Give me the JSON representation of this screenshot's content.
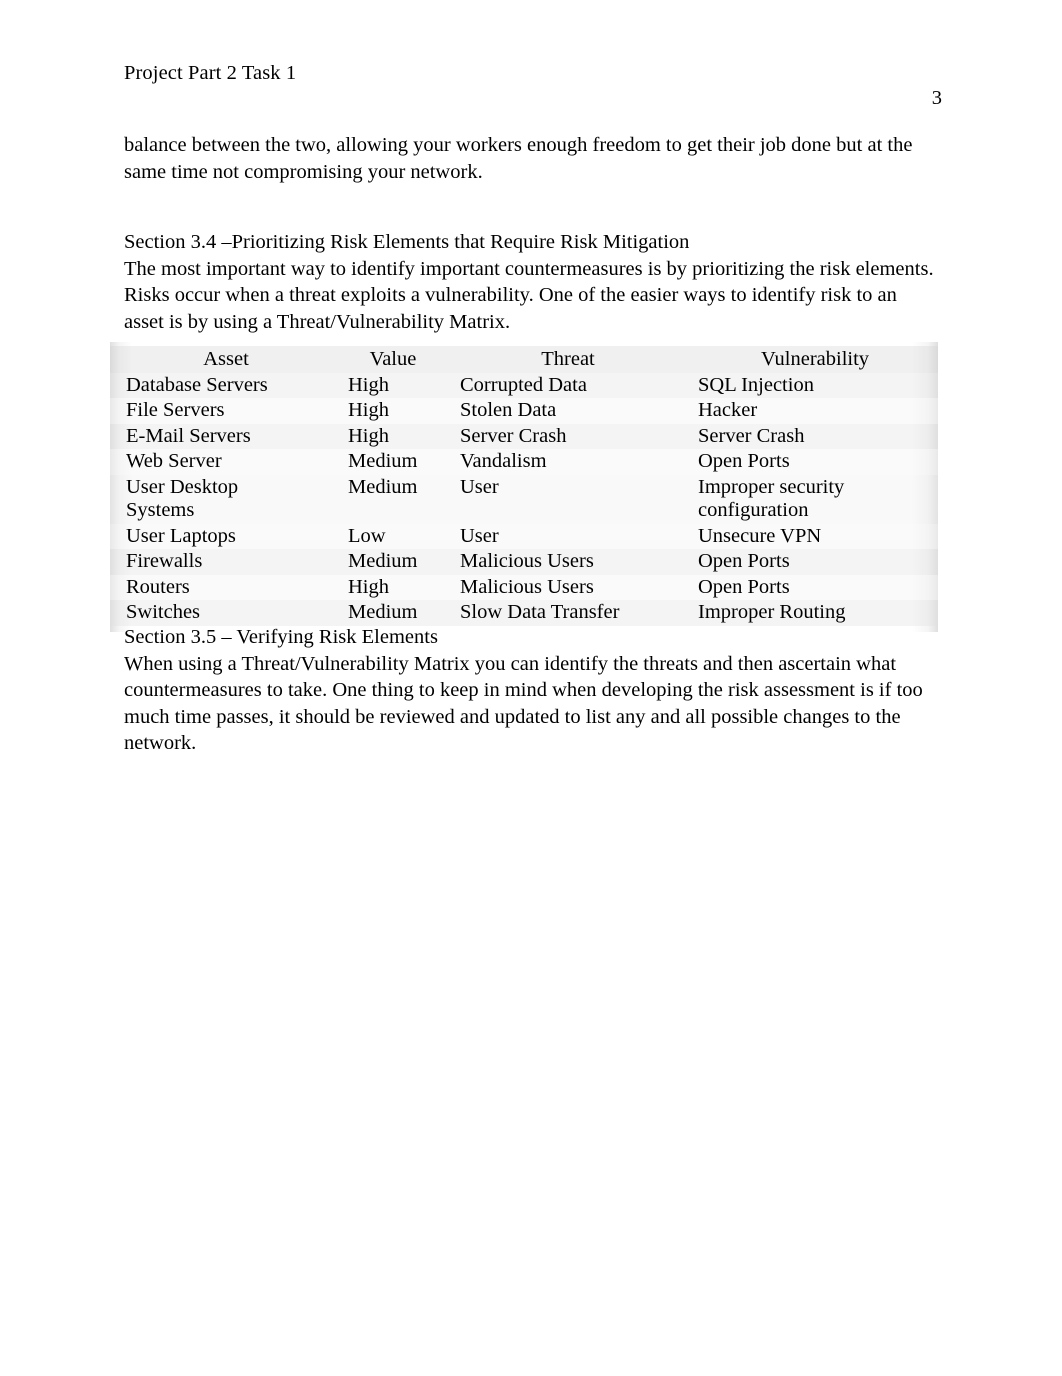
{
  "document": {
    "header_title": "Project Part 2 Task 1",
    "page_number": "3",
    "intro_paragraph": "balance between the two, allowing your workers enough freedom to get their job done but at the same time not compromising your network."
  },
  "section_34": {
    "heading": "Section 3.4 –Prioritizing Risk Elements that Require Risk Mitigation",
    "paragraph": "The most important way to identify important countermeasures is by prioritizing the risk elements. Risks occur when a threat exploits a vulnerability. One of the easier ways to identify risk to an asset is by using a Threat/Vulnerability Matrix."
  },
  "section_35": {
    "heading": "Section 3.5 – Verifying Risk Elements",
    "paragraph": "When using a Threat/Vulnerability Matrix you can identify the threats and then ascertain what countermeasures to take. One thing to keep in mind when developing the risk assessment is if too much time passes, it should be reviewed and updated to list any and all possible changes to the network."
  },
  "matrix": {
    "columns": [
      "Asset",
      "Value",
      "Threat",
      "Vulnerability"
    ],
    "rows": [
      {
        "asset": "Database Servers",
        "asset_line2": "",
        "value": "High",
        "threat": "Corrupted Data",
        "vulnerability": "SQL Injection",
        "vulnerability_line2": ""
      },
      {
        "asset": "File Servers",
        "asset_line2": "",
        "value": "High",
        "threat": "Stolen Data",
        "vulnerability": "Hacker",
        "vulnerability_line2": ""
      },
      {
        "asset": "E-Mail Servers",
        "asset_line2": "",
        "value": "High",
        "threat": "Server Crash",
        "vulnerability": "Server Crash",
        "vulnerability_line2": ""
      },
      {
        "asset": "Web Server",
        "asset_line2": "",
        "value": "Medium",
        "threat": "Vandalism",
        "vulnerability": "Open Ports",
        "vulnerability_line2": ""
      },
      {
        "asset": "User Desktop",
        "asset_line2": "Systems",
        "value": "Medium",
        "threat": "User",
        "vulnerability": "Improper security",
        "vulnerability_line2": "configuration"
      },
      {
        "asset": "User Laptops",
        "asset_line2": "",
        "value": "Low",
        "threat": "User",
        "vulnerability": "Unsecure VPN",
        "vulnerability_line2": ""
      },
      {
        "asset": "Firewalls",
        "asset_line2": "",
        "value": "Medium",
        "threat": "Malicious Users",
        "vulnerability": "Open Ports",
        "vulnerability_line2": ""
      },
      {
        "asset": "Routers",
        "asset_line2": "",
        "value": "High",
        "threat": "Malicious Users",
        "vulnerability": "Open Ports",
        "vulnerability_line2": ""
      },
      {
        "asset": "Switches",
        "asset_line2": "",
        "value": "Medium",
        "threat": "Slow Data Transfer",
        "vulnerability": "Improper Routing",
        "vulnerability_line2": ""
      }
    ]
  }
}
